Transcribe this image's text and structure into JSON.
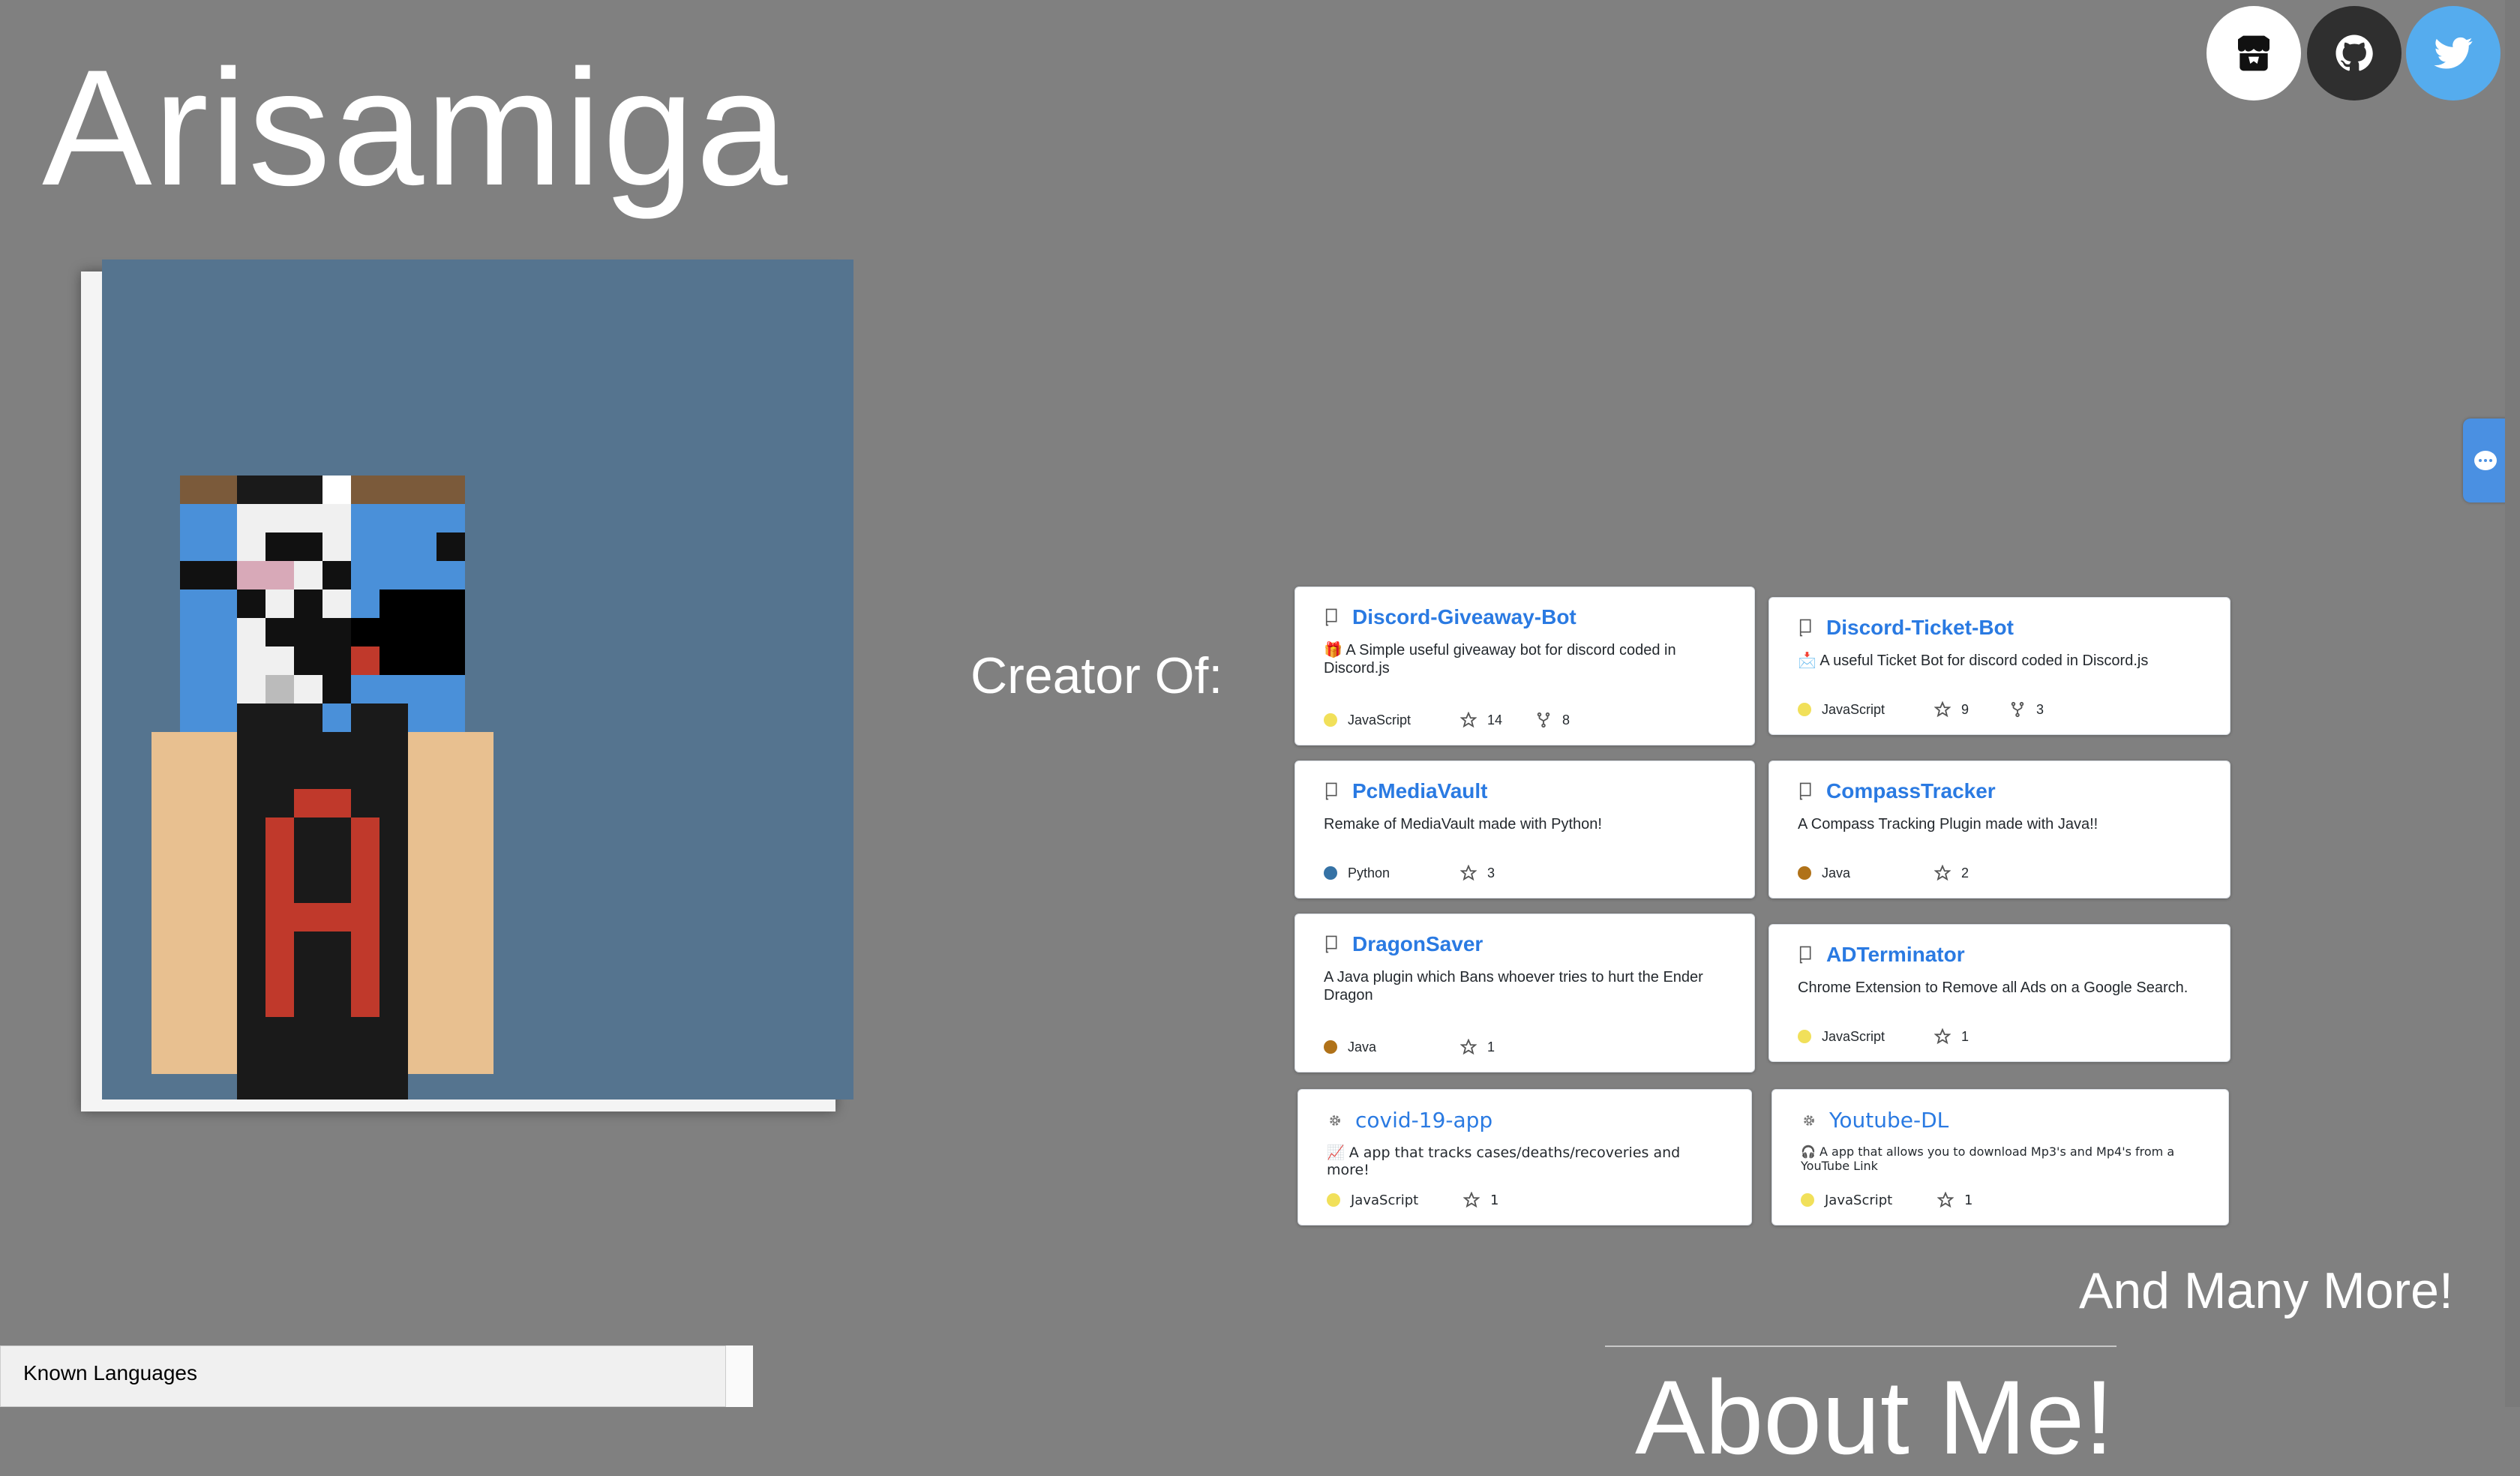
{
  "header": {
    "title": "Arisamiga"
  },
  "social": {
    "itch": "itchio-icon",
    "github": "github-icon",
    "twitter": "twitter-icon"
  },
  "section": {
    "creator_label": "Creator Of:",
    "more_label": "And Many More!",
    "about_label": "About Me!"
  },
  "known_languages": {
    "label": "Known Languages"
  },
  "colors": {
    "background": "#808080",
    "link": "#2a7ae2",
    "javascript": "#f1e05a",
    "python": "#3572a5",
    "java": "#b07219",
    "twitter": "#55acee"
  },
  "repos": [
    {
      "name": "Discord-Giveaway-Bot",
      "emoji": "🎁",
      "description": "A Simple useful giveaway bot for discord coded in Discord.js",
      "language": "JavaScript",
      "stars": "14",
      "forks": "8"
    },
    {
      "name": "Discord-Ticket-Bot",
      "emoji": "📩",
      "description": "A useful Ticket Bot for discord coded in Discord.js",
      "language": "JavaScript",
      "stars": "9",
      "forks": "3"
    },
    {
      "name": "PcMediaVault",
      "emoji": "",
      "description": "Remake of MediaVault made with Python!",
      "language": "Python",
      "stars": "3",
      "forks": ""
    },
    {
      "name": "CompassTracker",
      "emoji": "",
      "description": "A Compass Tracking Plugin made with Java!!",
      "language": "Java",
      "stars": "2",
      "forks": ""
    },
    {
      "name": "DragonSaver",
      "emoji": "",
      "description": "A Java plugin which Bans whoever tries to hurt the Ender Dragon",
      "language": "Java",
      "stars": "1",
      "forks": ""
    },
    {
      "name": "ADTerminator",
      "emoji": "",
      "description": "Chrome Extension to Remove all Ads on a Google Search.",
      "language": "JavaScript",
      "stars": "1",
      "forks": ""
    },
    {
      "name": "covid-19-app",
      "emoji": "📈",
      "description": "A app that tracks cases/deaths/recoveries and more!",
      "language": "JavaScript",
      "stars": "1",
      "forks": ""
    },
    {
      "name": "Youtube-DL",
      "emoji": "🎧",
      "description": "A app that allows you to download Mp3's and Mp4's from a YouTube Link",
      "language": "JavaScript",
      "stars": "1",
      "forks": ""
    }
  ]
}
